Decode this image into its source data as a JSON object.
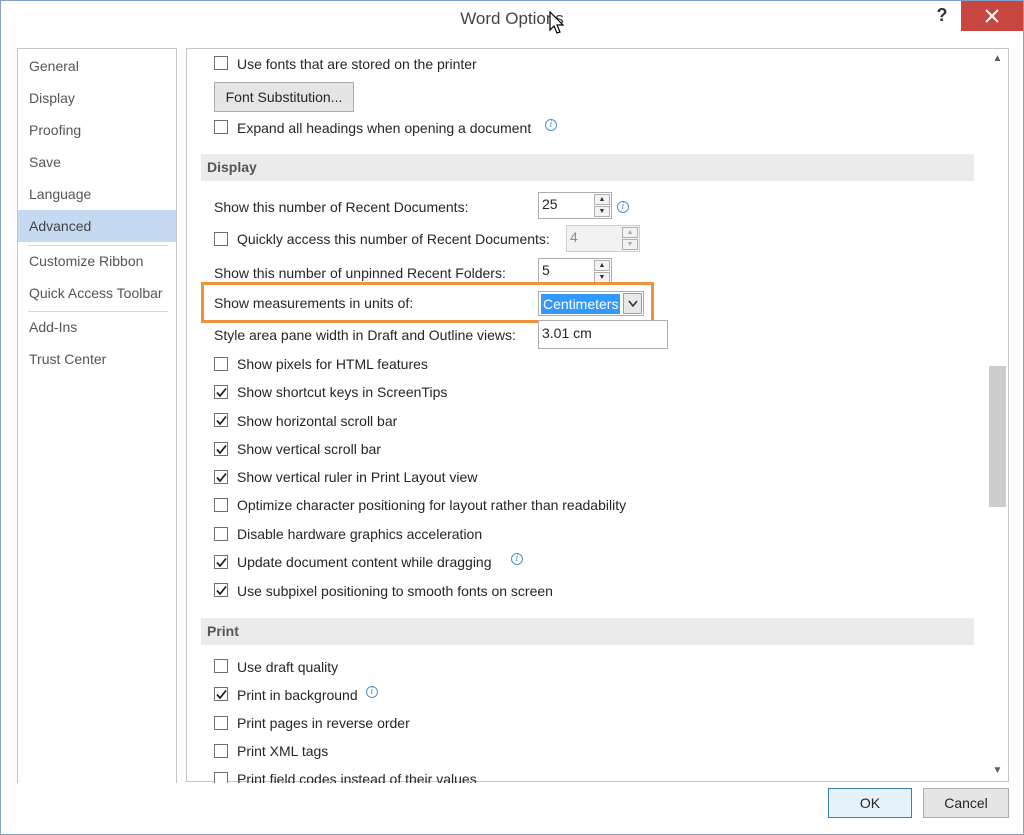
{
  "window": {
    "title": "Word Options",
    "help": "?"
  },
  "sidebar": {
    "items": [
      {
        "label": "General"
      },
      {
        "label": "Display"
      },
      {
        "label": "Proofing"
      },
      {
        "label": "Save"
      },
      {
        "label": "Language"
      },
      {
        "label": "Advanced",
        "active": true
      },
      {
        "label": "Customize Ribbon"
      },
      {
        "label": "Quick Access Toolbar"
      },
      {
        "label": "Add-Ins"
      },
      {
        "label": "Trust Center"
      }
    ]
  },
  "top": {
    "use_printer_fonts": {
      "label": "Use fonts that are stored on the printer",
      "checked": false
    },
    "font_substitution_button": "Font Substitution...",
    "expand_headings": {
      "label": "Expand all headings when opening a document",
      "checked": false
    }
  },
  "display": {
    "header": "Display",
    "recent_docs": {
      "label": "Show this number of Recent Documents:",
      "value": "25"
    },
    "quick_access": {
      "label": "Quickly access this number of Recent Documents:",
      "value": "4",
      "checked": false
    },
    "unpinned_folders": {
      "label": "Show this number of unpinned Recent Folders:",
      "value": "5"
    },
    "measurements": {
      "label": "Show measurements in units of:",
      "value": "Centimeters"
    },
    "style_area": {
      "label": "Style area pane width in Draft and Outline views:",
      "value": "3.01 cm"
    },
    "checkboxes": [
      {
        "label": "Show pixels for HTML features",
        "checked": false
      },
      {
        "label": "Show shortcut keys in ScreenTips",
        "checked": true
      },
      {
        "label": "Show horizontal scroll bar",
        "checked": true
      },
      {
        "label": "Show vertical scroll bar",
        "checked": true
      },
      {
        "label": "Show vertical ruler in Print Layout view",
        "checked": true
      },
      {
        "label": "Optimize character positioning for layout rather than readability",
        "checked": false
      },
      {
        "label": "Disable hardware graphics acceleration",
        "checked": false
      },
      {
        "label": "Update document content while dragging",
        "checked": true
      },
      {
        "label": "Use subpixel positioning to smooth fonts on screen",
        "checked": true
      }
    ]
  },
  "print": {
    "header": "Print",
    "checkboxes": [
      {
        "label": "Use draft quality",
        "checked": false
      },
      {
        "label": "Print in background",
        "checked": true
      },
      {
        "label": "Print pages in reverse order",
        "checked": false
      },
      {
        "label": "Print XML tags",
        "checked": false
      },
      {
        "label": "Print field codes instead of their values",
        "checked": false
      }
    ]
  },
  "footer": {
    "ok": "OK",
    "cancel": "Cancel"
  },
  "colors": {
    "accent_highlight": "#f0913b",
    "selection": "#3399ff",
    "nav_active": "#c5d9f1",
    "close": "#c7463f"
  }
}
